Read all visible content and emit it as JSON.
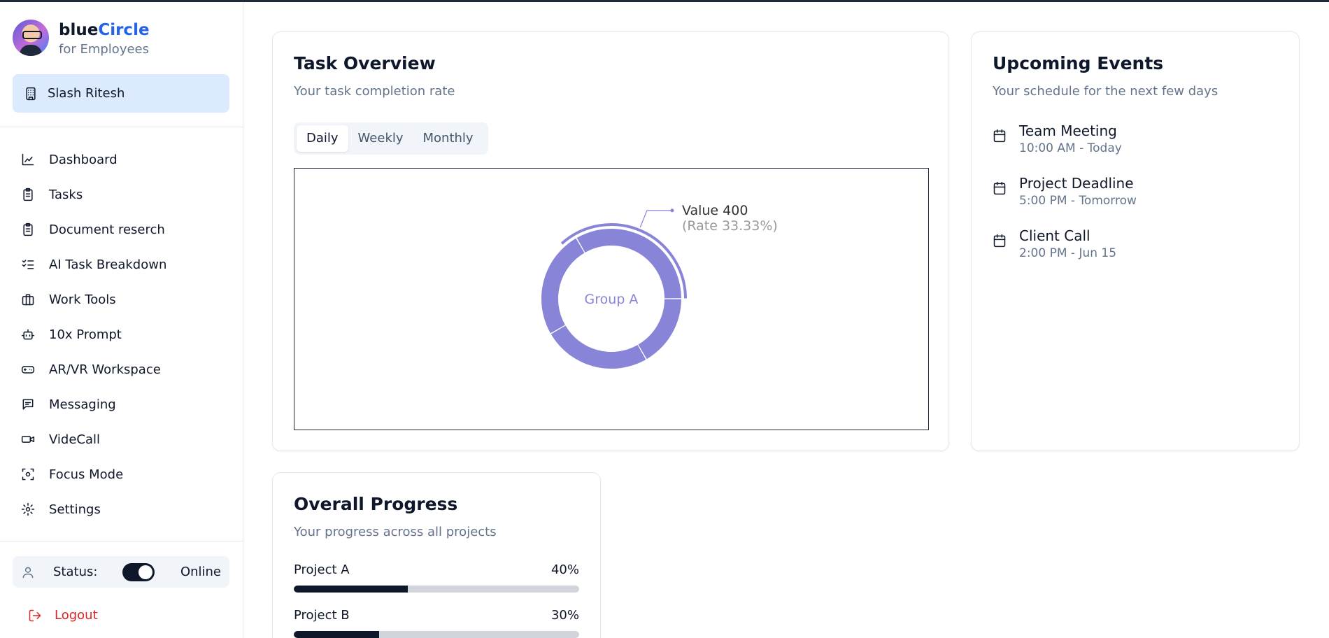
{
  "brand": {
    "name_prefix": "blue",
    "name_accent": "Circle",
    "subtitle": "for Employees"
  },
  "org": {
    "label": "Slash Ritesh",
    "icon": "building-icon"
  },
  "nav": {
    "items": [
      {
        "label": "Dashboard",
        "icon": "chart-icon"
      },
      {
        "label": "Tasks",
        "icon": "clipboard-icon"
      },
      {
        "label": "Document reserch",
        "icon": "clipboard-icon"
      },
      {
        "label": "AI Task Breakdown",
        "icon": "checklist-icon"
      },
      {
        "label": "Work Tools",
        "icon": "briefcase-icon"
      },
      {
        "label": "10x Prompt",
        "icon": "bot-icon"
      },
      {
        "label": "AR/VR Workspace",
        "icon": "gamepad-icon"
      },
      {
        "label": "Messaging",
        "icon": "message-icon"
      },
      {
        "label": "VideCall",
        "icon": "video-icon"
      },
      {
        "label": "Focus Mode",
        "icon": "scan-icon"
      },
      {
        "label": "Settings",
        "icon": "gear-icon"
      }
    ]
  },
  "status": {
    "label": "Status:",
    "value": "Online",
    "enabled": true
  },
  "logout": {
    "label": "Logout",
    "color": "#dc2626"
  },
  "task_overview": {
    "title": "Task Overview",
    "subtitle": "Your task completion rate",
    "tabs": [
      "Daily",
      "Weekly",
      "Monthly"
    ],
    "active_tab": "Daily"
  },
  "chart_data": {
    "type": "pie",
    "center_label": "Group A",
    "slices": [
      {
        "value": 400
      },
      {
        "value": 300
      },
      {
        "value": 300
      },
      {
        "value": 200
      }
    ],
    "active_tooltip": {
      "value_text": "Value 400",
      "rate_text": "(Rate 33.33%)"
    },
    "color": "#8884d8"
  },
  "events": {
    "title": "Upcoming Events",
    "subtitle": "Your schedule for the next few days",
    "items": [
      {
        "title": "Team Meeting",
        "time": "10:00 AM - Today"
      },
      {
        "title": "Project Deadline",
        "time": "5:00 PM - Tomorrow"
      },
      {
        "title": "Client Call",
        "time": "2:00 PM - Jun 15"
      }
    ]
  },
  "progress": {
    "title": "Overall Progress",
    "subtitle": "Your progress across all projects",
    "projects": [
      {
        "name": "Project A",
        "percent_label": "40%",
        "percent": 40
      },
      {
        "name": "Project B",
        "percent_label": "30%",
        "percent": 30
      }
    ]
  },
  "colors": {
    "accent": "#2563eb",
    "active_bg": "#dbeafe",
    "danger": "#dc2626"
  }
}
